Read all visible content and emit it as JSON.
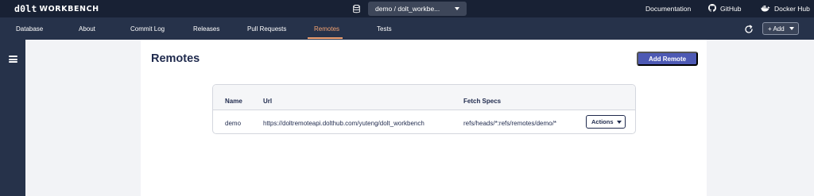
{
  "header": {
    "logo_mark": "d0lt",
    "logo_text": "WORKBENCH",
    "database_selector": "demo / dolt_workbe...",
    "links": [
      {
        "label": "Documentation",
        "icon": "none"
      },
      {
        "label": "GitHub",
        "icon": "github-icon"
      },
      {
        "label": "Docker Hub",
        "icon": "docker-icon"
      }
    ]
  },
  "tabs": [
    {
      "label": "Database"
    },
    {
      "label": "About"
    },
    {
      "label": "Commit Log"
    },
    {
      "label": "Releases"
    },
    {
      "label": "Pull Requests"
    },
    {
      "label": "Remotes",
      "active": true
    },
    {
      "label": "Tests"
    }
  ],
  "toolbar": {
    "add_label": "+ Add"
  },
  "page": {
    "title": "Remotes",
    "add_remote_label": "Add Remote"
  },
  "table": {
    "headers": [
      "Name",
      "Url",
      "Fetch Specs"
    ],
    "rows": [
      {
        "name": "demo",
        "url": "https://doltremoteapi.dolthub.com/yuteng/dolt_workbench",
        "fetch_specs": "refs/heads/*:refs/remotes/demo/*",
        "actions_label": "Actions"
      }
    ]
  },
  "colors": {
    "topbar": "#182134",
    "navbar": "#26324a",
    "active_tab": "#f2a170",
    "primary_button": "#4d59b4",
    "text_dark": "#1f2a4d"
  }
}
